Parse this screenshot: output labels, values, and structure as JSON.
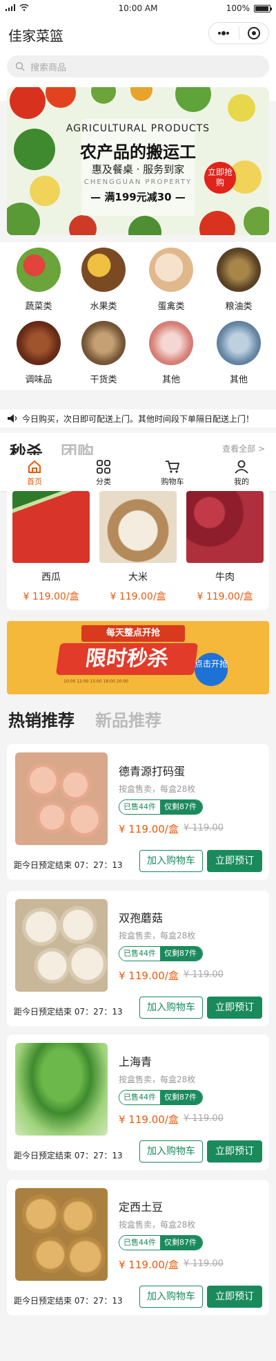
{
  "status_bar": {
    "time": "10:00 AM",
    "battery": "100%"
  },
  "header": {
    "title": "佳家菜篮",
    "search_placeholder": "搜索商品"
  },
  "banner": {
    "title_en": "AGRICULTURAL PRODUCTS",
    "title_cn": "农产品的搬运工",
    "subtitle": "惠及餐桌 · 服务到家",
    "en_sub": "CHENGGUAN PROPERTY",
    "deal": "— 满199元减30 —",
    "badge": "立即抢购"
  },
  "categories": [
    {
      "label": "蔬菜类",
      "icon": "vegetables-icon",
      "color": "#6aa43a"
    },
    {
      "label": "水果类",
      "icon": "fruits-icon",
      "color": "#d8a23a"
    },
    {
      "label": "蛋禽类",
      "icon": "eggs-icon",
      "color": "#e8c7a4"
    },
    {
      "label": "粮油类",
      "icon": "grains-icon",
      "color": "#8a6a3a"
    },
    {
      "label": "调味品",
      "icon": "spices-icon",
      "color": "#7a3b22"
    },
    {
      "label": "干货类",
      "icon": "dried-goods-icon",
      "color": "#7a5a3a"
    },
    {
      "label": "其他",
      "icon": "meat-icon",
      "color": "#e8b4b0"
    },
    {
      "label": "其他",
      "icon": "fish-icon",
      "color": "#6a8aa8"
    }
  ],
  "notice": "今日购买，次日即可配送上门。其他时间段下单隔日配送上门！",
  "seckill": {
    "title": "秒杀",
    "alt_title": "团购",
    "more": "查看全部 >"
  },
  "tabbar": [
    {
      "label": "首页",
      "icon": "home-icon"
    },
    {
      "label": "分类",
      "icon": "category-icon"
    },
    {
      "label": "购物车",
      "icon": "cart-icon"
    },
    {
      "label": "我的",
      "icon": "user-icon"
    }
  ],
  "seckill_items": [
    {
      "name": "西瓜",
      "price": "¥ 119.00/盒",
      "color": "#c0322a"
    },
    {
      "name": "大米",
      "price": "¥ 119.00/盒",
      "color": "#d9c9a8"
    },
    {
      "name": "牛肉",
      "price": "¥ 119.00/盒",
      "color": "#9a2230"
    }
  ],
  "flash_banner": {
    "ribbon": "每天整点开抢",
    "title": "限时秒杀",
    "badge": "点击开抢",
    "fine": "10:00 12:00 15:00 18:00 20:00"
  },
  "section_tabs": {
    "hot": "热销推荐",
    "new": "新品推荐"
  },
  "products": [
    {
      "name": "德青源打码蛋",
      "desc": "按盒售卖，每盒28枚",
      "sold": "已售44件",
      "remaining": "仅剩87件",
      "price": "¥ 119.00/盒",
      "old_price": "¥ 119.00",
      "countdown": "距今日预定结束 07：27：13",
      "add": "加入购物车",
      "order": "立即预订",
      "color": "#e8b8a0"
    },
    {
      "name": "双孢蘑菇",
      "desc": "按盒售卖，每盒28枚",
      "sold": "已售44件",
      "remaining": "仅剩87件",
      "price": "¥ 119.00/盒",
      "old_price": "¥ 119.00",
      "countdown": "距今日预定结束 07：27：13",
      "add": "加入购物车",
      "order": "立即预订",
      "color": "#e6dccb"
    },
    {
      "name": "上海青",
      "desc": "按盒售卖，每盒28枚",
      "sold": "已售44件",
      "remaining": "仅剩87件",
      "price": "¥ 119.00/盒",
      "old_price": "¥ 119.00",
      "countdown": "距今日预定结束 07：27：13",
      "add": "加入购物车",
      "order": "立即预订",
      "color": "#4f9a3a"
    },
    {
      "name": "定西土豆",
      "desc": "按盒售卖，每盒28枚",
      "sold": "已售44件",
      "remaining": "仅剩87件",
      "price": "¥ 119.00/盒",
      "old_price": "¥ 119.00",
      "countdown": "距今日预定结束 07：27：13",
      "add": "加入购物车",
      "order": "立即预订",
      "color": "#c99a52"
    }
  ]
}
